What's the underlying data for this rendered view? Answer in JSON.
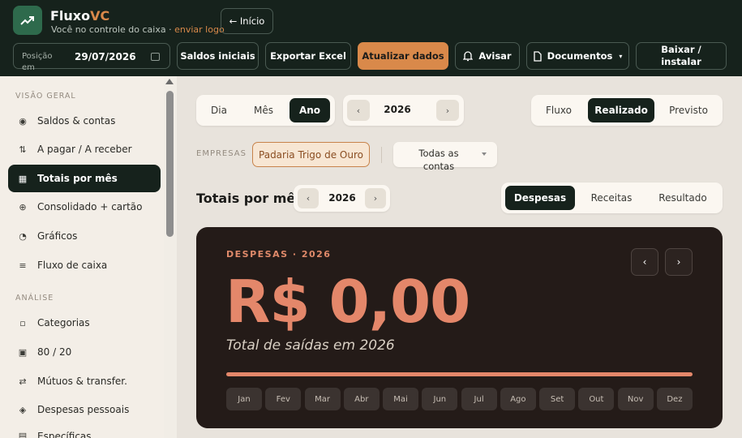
{
  "header": {
    "brand_main": "Fluxo",
    "brand_accent": "VC",
    "tagline": "Você no controle do caixa ·",
    "tagline_link": "enviar logo",
    "home_button": "← Início",
    "position_label": "Posição em",
    "position_date": "29/07/2026",
    "buttons": {
      "saldos": "Saldos iniciais",
      "exportar": "Exportar Excel",
      "atualizar": "Atualizar dados",
      "avisar": "Avisar",
      "documentos": "Documentos",
      "baixar": "Baixar / instalar"
    },
    "accent_color": "#d9894a"
  },
  "sidebar": {
    "section_geral": "VISÃO GERAL",
    "section_analise": "ANÁLISE",
    "items": [
      {
        "label": "Saldos & contas",
        "icon": "target-icon"
      },
      {
        "label": "A pagar / A receber",
        "icon": "updown-arrows-icon"
      },
      {
        "label": "Totais por mês",
        "icon": "grid-icon",
        "active": true
      },
      {
        "label": "Consolidado + cartão",
        "icon": "globe-icon"
      },
      {
        "label": "Gráficos",
        "icon": "pie-icon"
      },
      {
        "label": "Fluxo de caixa",
        "icon": "list-icon"
      },
      {
        "label": "Categorias",
        "icon": "square-icon"
      },
      {
        "label": "80 / 20",
        "icon": "calendar-icon"
      },
      {
        "label": "Mútuos & transfer.",
        "icon": "swap-icon"
      },
      {
        "label": "Despesas pessoais",
        "icon": "diamond-icon"
      },
      {
        "label": "Específicas",
        "icon": "doc-icon"
      }
    ]
  },
  "period": {
    "dia": "Dia",
    "mes": "Mês",
    "ano": "Ano",
    "year": "2026"
  },
  "view": {
    "fluxo": "Fluxo",
    "realizado": "Realizado",
    "previsto": "Previsto"
  },
  "filters": {
    "empresas_label": "EMPRESAS",
    "empresa": "Padaria Trigo de Ouro",
    "contas": "Todas as contas"
  },
  "totals": {
    "title": "Totais por mês",
    "year": "2026",
    "tabs": {
      "despesas": "Despesas",
      "receitas": "Receitas",
      "resultado": "Resultado"
    }
  },
  "card": {
    "label": "DESPESAS · 2026",
    "amount": "R$ 0,00",
    "subtitle": "Total de saídas em 2026",
    "progress": 1.0,
    "months": [
      "Jan",
      "Fev",
      "Mar",
      "Abr",
      "Mai",
      "Jun",
      "Jul",
      "Ago",
      "Set",
      "Out",
      "Nov",
      "Dez"
    ]
  }
}
